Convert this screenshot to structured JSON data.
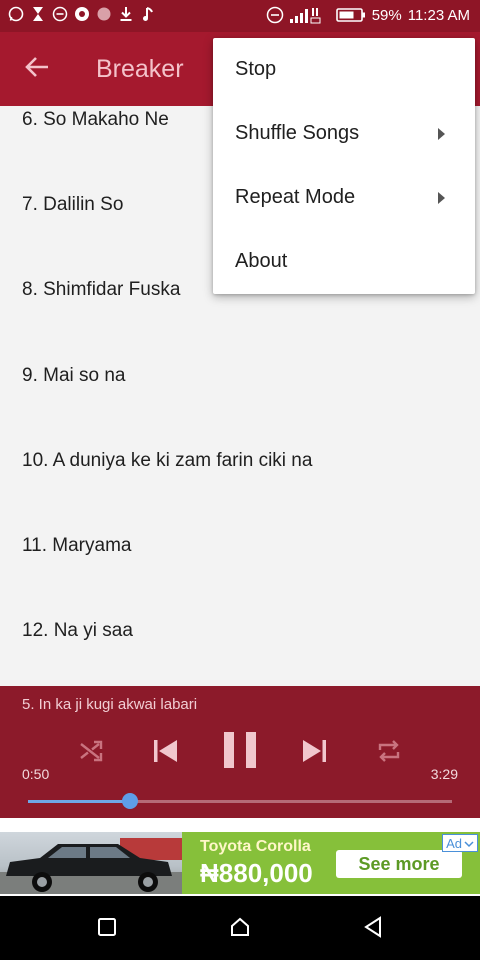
{
  "status_bar": {
    "left_icons": [
      "whatsapp-icon",
      "hourglass-icon",
      "minus-circle-icon",
      "chrome-icon",
      "record-dot-icon",
      "download-icon",
      "music-note-icon"
    ],
    "right_icons": [
      "dnd-icon",
      "signal-icon",
      "battery-icon"
    ],
    "battery": "59%",
    "time": "11:23 AM"
  },
  "app_bar": {
    "back_icon": "arrow-left-icon",
    "title": "Breaker"
  },
  "songs": [
    "6. So Makaho Ne",
    "7. Dalilin So",
    "8. Shimfidar Fuska",
    "9. Mai so na",
    "10. A duniya ke ki zam farin ciki na",
    "11. Maryama",
    "12. Na yi saa"
  ],
  "menu": {
    "items": [
      {
        "label": "Stop",
        "submenu": false
      },
      {
        "label": "Shuffle Songs",
        "submenu": true
      },
      {
        "label": "Repeat Mode",
        "submenu": true
      },
      {
        "label": "About",
        "submenu": false
      }
    ]
  },
  "player": {
    "now_playing": "5. In ka ji kugi akwai labari",
    "current_time": "0:50",
    "total_time": "3:29",
    "progress": 0.24,
    "controls": [
      "shuffle-icon",
      "skip-previous-icon",
      "pause-icon",
      "skip-next-icon",
      "repeat-icon"
    ]
  },
  "ad": {
    "title": "Toyota Corolla",
    "price": "₦880,000",
    "cta": "See more",
    "badge": "Ad"
  },
  "nav_bar": {
    "icons": [
      "recents-square-icon",
      "home-icon",
      "back-triangle-icon"
    ]
  },
  "colors": {
    "status_bar": "#8e1526",
    "app_bar": "#a5192e",
    "player": "#8c1a2a",
    "progress_accent": "#5e9de8",
    "ad_green": "#86c03a"
  }
}
